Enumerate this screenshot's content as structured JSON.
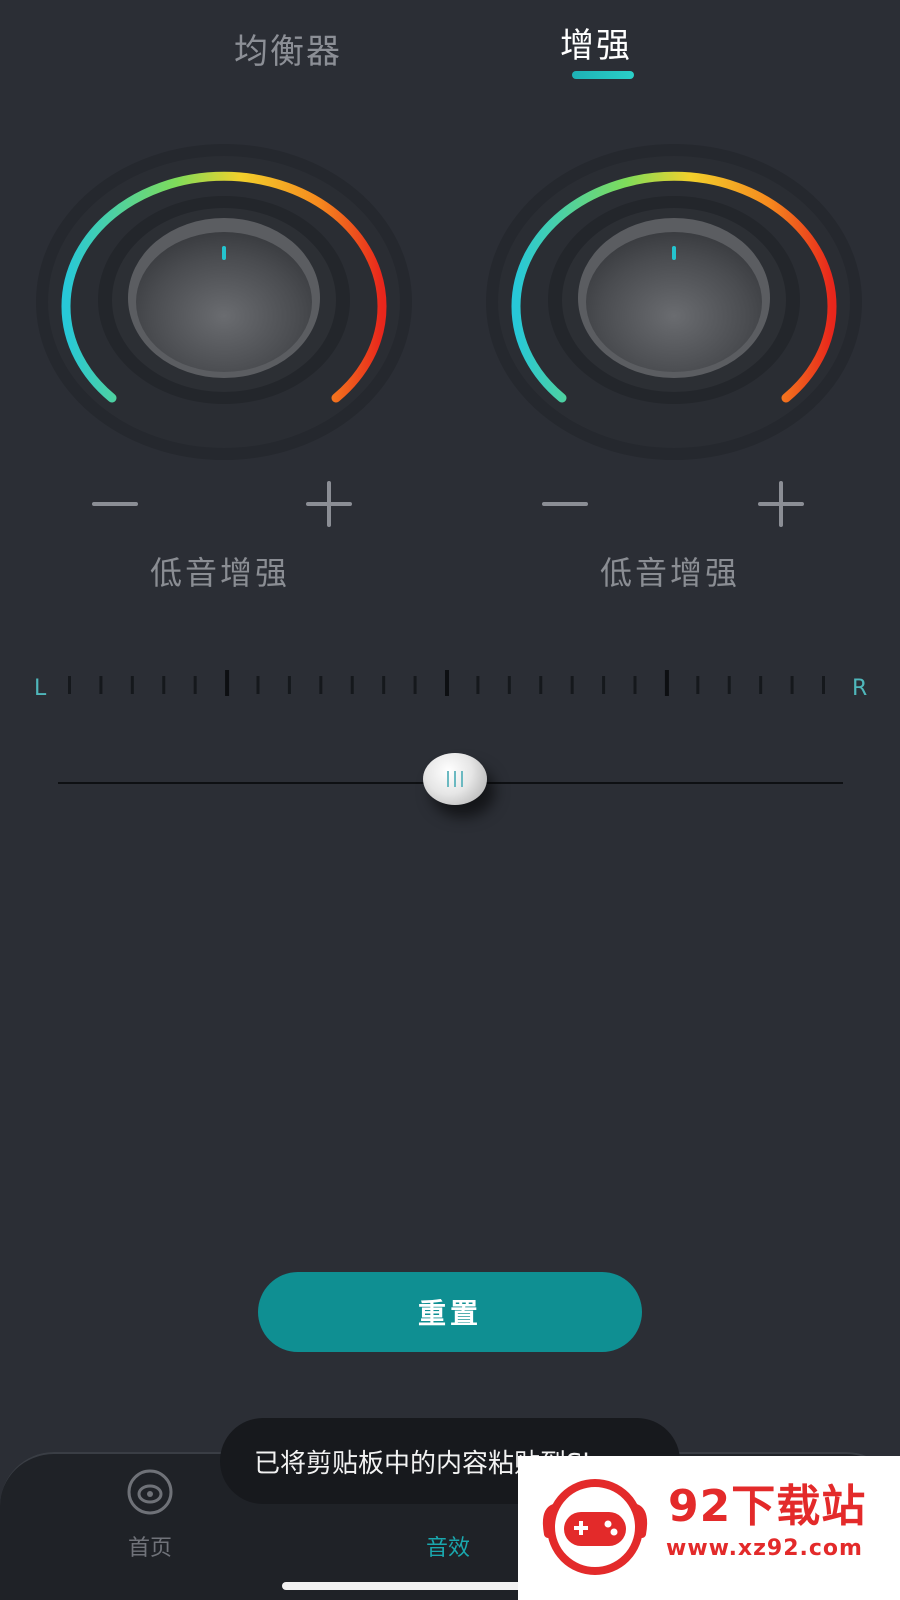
{
  "tabs": [
    {
      "label": "均衡器",
      "active": false
    },
    {
      "label": "增强",
      "active": true
    }
  ],
  "knobs": [
    {
      "label": "低音增强",
      "minus_icon": "minus-icon",
      "plus_icon": "plus-icon"
    },
    {
      "label": "低音增强",
      "minus_icon": "minus-icon",
      "plus_icon": "plus-icon"
    }
  ],
  "balance": {
    "left_label": "L",
    "right_label": "R",
    "value_fraction": 0.5
  },
  "reset_button": {
    "label": "重置"
  },
  "bottom_nav": {
    "items": [
      {
        "label": "首页",
        "icon": "disc-icon"
      },
      {
        "label": "音效",
        "active": true
      }
    ]
  },
  "toast": {
    "text": "已将剪贴板中的内容粘贴到Sh..."
  },
  "watermark": {
    "title": "92下载站",
    "url": "www.xz92.com"
  },
  "colors": {
    "background": "#2b2e35",
    "accent": "#0f8f92",
    "active_tab": "#ffffff",
    "inactive_text": "#8a8d93"
  }
}
